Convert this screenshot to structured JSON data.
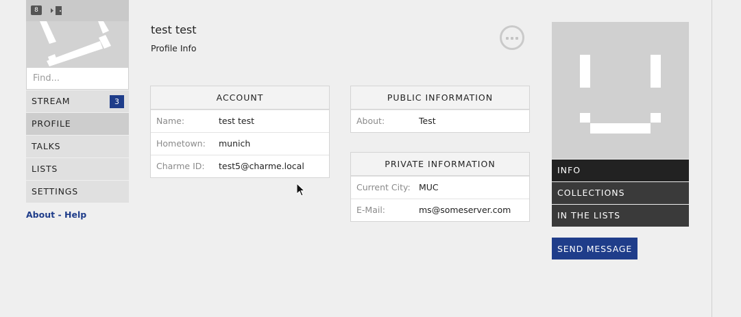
{
  "sidebar": {
    "notification_count": "8",
    "search_placeholder": "Find...",
    "nav": [
      {
        "label": "STREAM",
        "badge": "3"
      },
      {
        "label": "PROFILE"
      },
      {
        "label": "TALKS"
      },
      {
        "label": "LISTS"
      },
      {
        "label": "SETTINGS"
      }
    ],
    "about_label": "About",
    "separator": " - ",
    "help_label": "Help"
  },
  "profile": {
    "name": "test test",
    "subtitle": "Profile Info"
  },
  "account": {
    "heading": "ACCOUNT",
    "rows": [
      {
        "key": "Name:",
        "value": "test test"
      },
      {
        "key": "Hometown:",
        "value": "munich"
      },
      {
        "key": "Charme ID:",
        "value": "test5@charme.local"
      }
    ]
  },
  "public_info": {
    "heading": "PUBLIC INFORMATION",
    "rows": [
      {
        "key": "About:",
        "value": "Test"
      }
    ]
  },
  "private_info": {
    "heading": "PRIVATE INFORMATION",
    "rows": [
      {
        "key": "Current City:",
        "value": "MUC"
      },
      {
        "key": "E-Mail:",
        "value": "ms@someserver.com"
      }
    ]
  },
  "right_panel": {
    "nav": [
      {
        "label": "INFO"
      },
      {
        "label": "COLLECTIONS"
      },
      {
        "label": "IN THE LISTS"
      }
    ],
    "send_label": "SEND MESSAGE"
  },
  "colors": {
    "accent": "#1f3d8a",
    "dark_nav": "#3a3a3a",
    "dark_nav_active": "#222222"
  }
}
